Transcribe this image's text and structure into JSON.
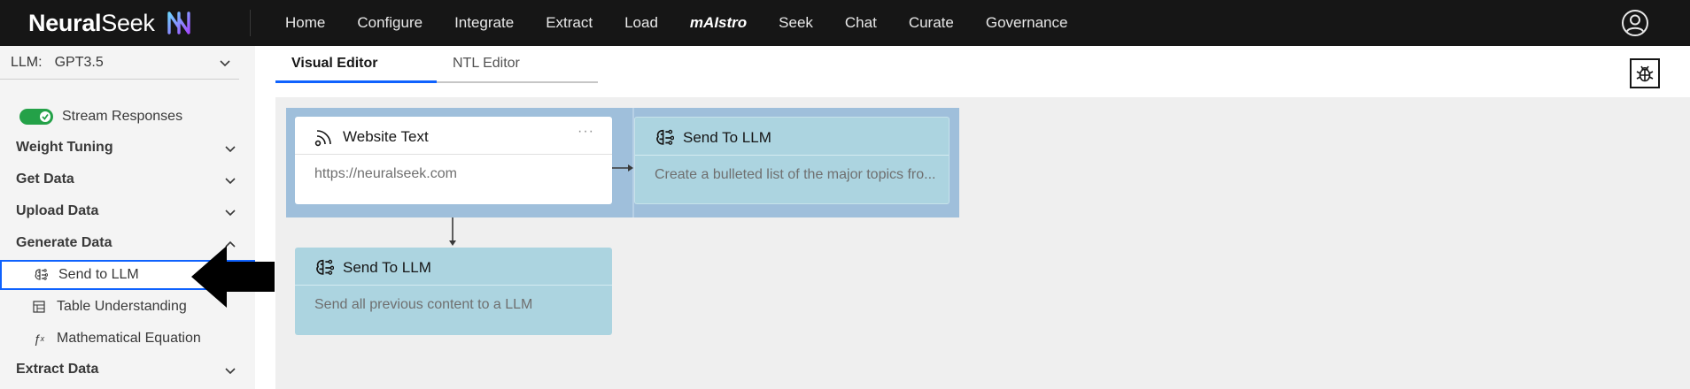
{
  "brand": {
    "name_bold": "Neural",
    "name_light": "Seek"
  },
  "nav": {
    "items": [
      "Home",
      "Configure",
      "Integrate",
      "Extract",
      "Load",
      "mAIstro",
      "Seek",
      "Chat",
      "Curate",
      "Governance"
    ]
  },
  "sidebar": {
    "llm_label": "LLM:",
    "llm_value": "GPT3.5",
    "stream_label": "Stream Responses",
    "stream_enabled": true,
    "sections": [
      "Weight Tuning",
      "Get Data",
      "Upload Data",
      "Generate Data"
    ],
    "generate_items": [
      "Send to LLM",
      "Table Understanding",
      "Mathematical Equation"
    ],
    "extract_section": "Extract Data"
  },
  "tabs": {
    "visual": "Visual Editor",
    "ntl": "NTL Editor",
    "active": "Visual Editor"
  },
  "nodes": {
    "website": {
      "title": "Website Text",
      "body": "https://neuralseek.com",
      "menu": "···"
    },
    "send1": {
      "title": "Send To LLM",
      "body": "Create a bulleted list of the major topics fro..."
    },
    "send2": {
      "title": "Send To LLM",
      "body": "Send all previous content to a LLM"
    }
  },
  "colors": {
    "topbar": "#161616",
    "accent": "#0f62fe",
    "toggle_on": "#24a148",
    "node_blue": "#acd4e0",
    "group_blue": "#9fbfdb"
  },
  "icons": [
    "user-avatar-icon",
    "chevron-down-icon",
    "checkmark-icon",
    "llm-brain-icon",
    "table-icon",
    "function-icon",
    "bug-icon",
    "rss-icon",
    "overflow-menu-icon"
  ]
}
